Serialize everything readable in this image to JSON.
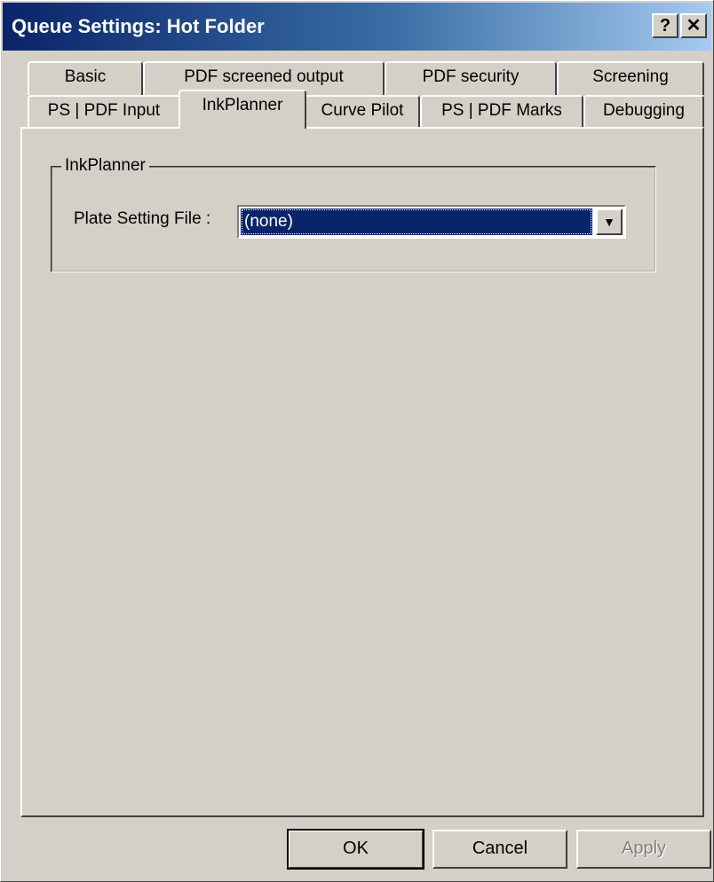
{
  "window": {
    "title": "Queue Settings: Hot Folder",
    "help_glyph": "?",
    "close_glyph": "✕"
  },
  "tabs": {
    "row1": [
      {
        "label": "Basic"
      },
      {
        "label": "PDF screened output"
      },
      {
        "label": "PDF security"
      },
      {
        "label": "Screening"
      }
    ],
    "row2": [
      {
        "label": "PS | PDF Input"
      },
      {
        "label": "InkPlanner",
        "active": true
      },
      {
        "label": "Curve Pilot"
      },
      {
        "label": "PS | PDF Marks"
      },
      {
        "label": "Debugging"
      }
    ]
  },
  "inkplanner": {
    "group_title": "InkPlanner",
    "plate_setting_label": "Plate Setting File :",
    "plate_setting_value": "(none)",
    "dropdown_icon": "dropdown-arrow-icon"
  },
  "buttons": {
    "ok": "OK",
    "cancel": "Cancel",
    "apply": "Apply"
  }
}
